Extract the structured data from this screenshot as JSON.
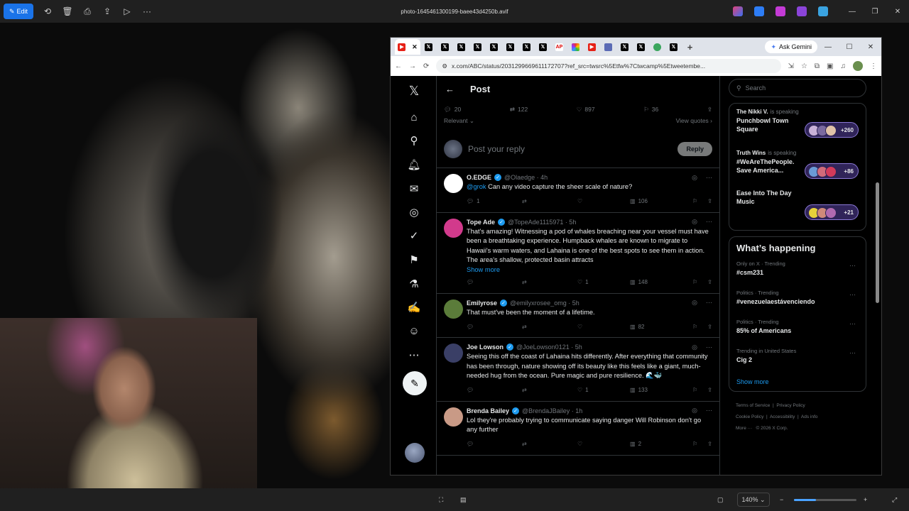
{
  "viewer": {
    "edit_label": "Edit",
    "file_name": "photo-1645461300199-baee43d4250b.avif",
    "zoom": "140%",
    "zoom_level": 0.35
  },
  "browser": {
    "ask_gemini": "Ask Gemini",
    "url": "x.com/ABC/status/2031299669611172707?ref_src=twsrc%5Etfw%7Ctwcamp%5Etweetembe...",
    "tabs": [
      "YouTube",
      "X",
      "X",
      "X",
      "X",
      "X",
      "X",
      "X",
      "X",
      "AP",
      "NBC",
      "YouTube",
      "Site",
      "X",
      "X",
      "Site",
      "X"
    ]
  },
  "post": {
    "header": "Post",
    "stats": {
      "replies": "20",
      "reposts": "122",
      "likes": "897",
      "bookmarks": "36"
    },
    "sort": "Relevant",
    "view_quotes": "View quotes",
    "reply_placeholder": "Post your reply",
    "reply_button": "Reply"
  },
  "replies": [
    {
      "name": "O.EDGE",
      "handle": "@Olaedge · 4h",
      "mention": "@grok",
      "text": "Can any video capture the sheer scale of nature?",
      "show_more": "",
      "replies": "1",
      "reposts": "",
      "likes": "",
      "views": "106",
      "avatar_color": "#ffffff"
    },
    {
      "name": "Tope Ade",
      "handle": "@TopeAde1115971 · 5h",
      "mention": "",
      "text": "That's amazing! Witnessing a pod of whales breaching near your vessel must have been a breathtaking experience. Humpback whales are known to migrate to Hawaii's warm waters, and Lahaina is one of the best spots to see them in action. The area's shallow, protected basin attracts",
      "show_more": "Show more",
      "replies": "",
      "reposts": "",
      "likes": "1",
      "views": "148",
      "avatar_color": "#d23a8c"
    },
    {
      "name": "Emilyrose",
      "handle": "@emilyxrosee_omg · 5h",
      "mention": "",
      "text": "That must've been the moment of a lifetime.",
      "show_more": "",
      "replies": "",
      "reposts": "",
      "likes": "",
      "views": "82",
      "avatar_color": "#5b7c3a"
    },
    {
      "name": "Joe Lowson",
      "handle": "@JoeLowson0121 · 5h",
      "mention": "",
      "text": "Seeing this off the coast of Lahaina hits differently. After everything that community has been through, nature showing off its beauty like this feels like a giant, much-needed hug from the ocean. Pure magic and pure resilience. 🌊🐳",
      "show_more": "",
      "replies": "",
      "reposts": "",
      "likes": "1",
      "views": "133",
      "avatar_color": "#3a3f66"
    },
    {
      "name": "Brenda Bailey",
      "handle": "@BrendaJBailey · 1h",
      "mention": "",
      "text": "Lol they're probably trying to communicate saying danger Will Robinson don't go any further",
      "show_more": "",
      "replies": "",
      "reposts": "",
      "likes": "",
      "views": "2",
      "avatar_color": "#c99a86"
    }
  ],
  "sidebar": {
    "search_placeholder": "Search",
    "spaces": [
      {
        "host": "The Nikki V.",
        "status": "is speaking",
        "title": "Punchbowl Town Square",
        "count": "+260"
      },
      {
        "host": "Truth Wins",
        "status": "is speaking",
        "title": "#WeAreThePeople. Save America...",
        "count": "+86"
      },
      {
        "host": "",
        "status": "",
        "title": "Ease Into The Day Music",
        "count": "+21"
      }
    ],
    "happening_title": "What’s happening",
    "trends": [
      {
        "meta": "Only on X · Trending",
        "name": "#csm231"
      },
      {
        "meta": "Politics · Trending",
        "name": "#venezuelaestávenciendo"
      },
      {
        "meta": "Politics · Trending",
        "name": "85% of Americans"
      },
      {
        "meta": "Trending in United States",
        "name": "Cig 2"
      }
    ],
    "show_more": "Show more",
    "footer": [
      "Terms of Service",
      "Privacy Policy",
      "Cookie Policy",
      "Accessibility",
      "Ads info",
      "More ···",
      "© 2026 X Corp."
    ]
  }
}
